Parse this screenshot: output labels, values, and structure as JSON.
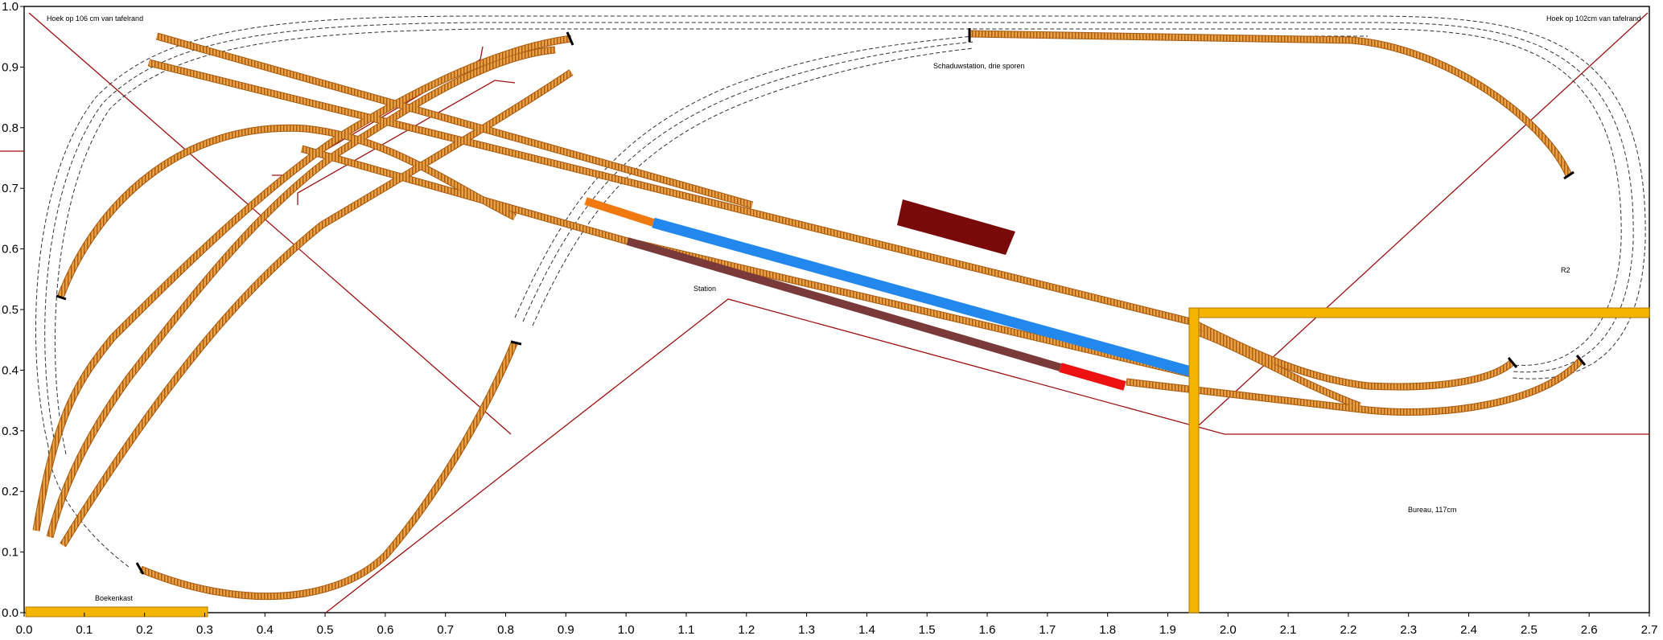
{
  "axes": {
    "x_ticks": [
      "0.0",
      "0.1",
      "0.2",
      "0.3",
      "0.4",
      "0.5",
      "0.6",
      "0.7",
      "0.8",
      "0.9",
      "1.0",
      "1.1",
      "1.2",
      "1.3",
      "1.4",
      "1.5",
      "1.6",
      "1.7",
      "1.8",
      "1.9",
      "2.0",
      "2.1",
      "2.2",
      "2.3",
      "2.4",
      "2.5",
      "2.6",
      "2.7"
    ],
    "y_ticks": [
      "0.0",
      "0.1",
      "0.2",
      "0.3",
      "0.4",
      "0.5",
      "0.6",
      "0.7",
      "0.8",
      "0.9",
      "1.0"
    ],
    "x_range": [
      0,
      2.7
    ],
    "y_range": [
      0,
      1.0
    ]
  },
  "labels": {
    "corner_left": "Hoek op 106 cm van tafelrand",
    "corner_right": "Hoek op 102cm van tafelrand",
    "shadow_station": "Schaduwstation, drie sporen",
    "station": "Station",
    "r2": "R2",
    "bureau": "Bureau, 117cm",
    "boekenkast": "Boekenkast"
  },
  "colors": {
    "track": "#e8a040",
    "track_dark": "#a85a10",
    "hidden_track": "#333333",
    "furniture": "#f4b400",
    "furniture_edge": "#b07800",
    "outline": "#a01010",
    "platform_blue": "#2288ee",
    "train_brown": "#7b3a3a",
    "loco_red": "#ee1111",
    "loco_orange": "#f07a10",
    "building": "#7a0a0a"
  }
}
